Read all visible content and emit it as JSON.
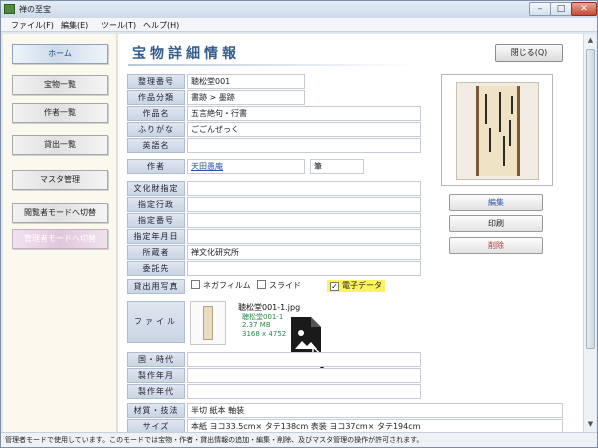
{
  "window": {
    "title": "禅の至宝",
    "minimize": "–",
    "maximize": "□",
    "close": "✕"
  },
  "menu": {
    "items": [
      "ファイル(F)",
      "編集(E)",
      "ツール(T)",
      "ヘルプ(H)"
    ]
  },
  "sidebar": {
    "items": [
      {
        "label": "ホーム"
      },
      {
        "label": "宝物一覧"
      },
      {
        "label": "作者一覧"
      },
      {
        "label": "貸出一覧"
      },
      {
        "label": "マスタ管理"
      },
      {
        "label": "閲覧者モードへ切替"
      },
      {
        "label": "管理者モードへ切替"
      }
    ]
  },
  "page": {
    "title": "宝物詳細情報",
    "close_button": "閉じる(Q)"
  },
  "fields": {
    "id": {
      "label": "整理番号",
      "value": "聴松堂001"
    },
    "category": {
      "label": "作品分類",
      "value": "書跡 > 墨跡"
    },
    "name": {
      "label": "作品名",
      "value": "五言絶句・行書"
    },
    "kana": {
      "label": "ふりがな",
      "value": "ごごんぜっく"
    },
    "english": {
      "label": "英語名",
      "value": ""
    },
    "author": {
      "label": "作者",
      "value": "天田愚庵",
      "suffix": "筆"
    },
    "cultural": {
      "label": "文化財指定",
      "value": ""
    },
    "admin": {
      "label": "指定行政",
      "value": ""
    },
    "designation_no": {
      "label": "指定番号",
      "value": ""
    },
    "designation_date": {
      "label": "指定年月日",
      "value": ""
    },
    "owner": {
      "label": "所蔵者",
      "value": "禅文化研究所"
    },
    "trustee": {
      "label": "委託先",
      "value": ""
    },
    "loan_photo": {
      "label": "貸出用写真"
    },
    "file": {
      "label": "ファイル"
    },
    "era": {
      "label": "国・時代",
      "value": ""
    },
    "made_month": {
      "label": "製作年月",
      "value": ""
    },
    "made_year": {
      "label": "製作年代",
      "value": ""
    },
    "material": {
      "label": "材質・技法",
      "value": "半切 紙本 軸装"
    },
    "size": {
      "label": "サイズ",
      "value": "本紙 ヨコ33.5cm× タテ138cm 表装 ヨコ37cm× タテ194cm"
    }
  },
  "checkboxes": [
    {
      "label": "ネガフィルム",
      "checked": false,
      "mark": ""
    },
    {
      "label": "スライド",
      "checked": false,
      "mark": ""
    },
    {
      "label": "電子データ",
      "checked": true,
      "mark": "✓"
    }
  ],
  "file_info": {
    "name": "聴松堂001-1.jpg",
    "meta": [
      "聴松堂001-1",
      "2.37 MB",
      "3168 x 4752"
    ]
  },
  "actions": {
    "edit": "編集",
    "print": "印刷",
    "delete": "削除"
  },
  "scroll": {
    "up": "▲",
    "down": "▼"
  },
  "status": {
    "text": "管理者モードで使用しています。このモードでは宝物・作者・貸出情報の追加・編集・削除、及びマスタ管理の操作が許可されます。"
  },
  "colors": {
    "accent": "#355d8c",
    "highlight": "#fdf260",
    "link": "#2b4fb6",
    "delete": "#b83737"
  }
}
